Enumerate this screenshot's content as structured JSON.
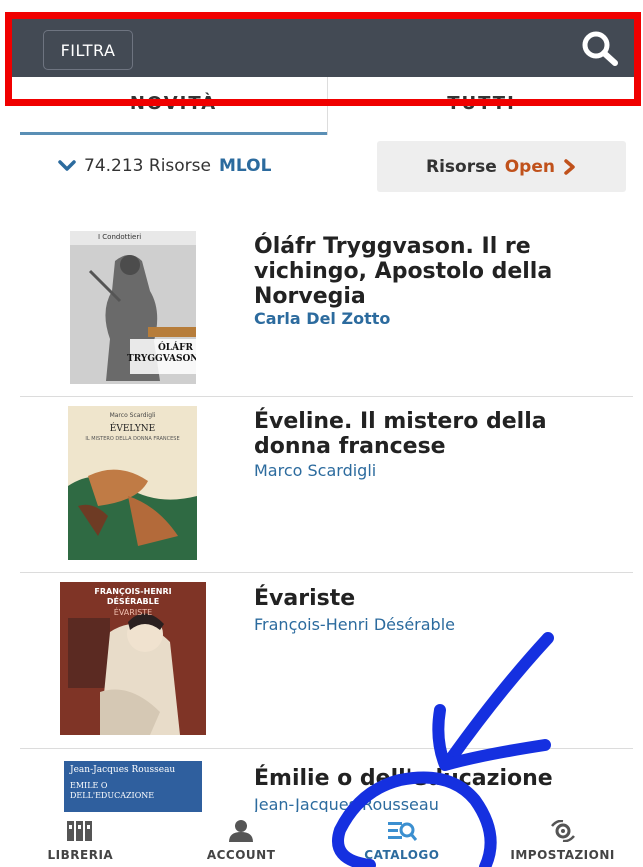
{
  "header": {
    "filter_label": "FILTRA",
    "search_icon": "search-icon"
  },
  "tabs": [
    {
      "label": "NOVITÀ",
      "active": true
    },
    {
      "label": "TUTTI",
      "active": false
    }
  ],
  "resources": {
    "mlol_count": "74.213 Risorse",
    "mlol_label": "MLOL",
    "open_prefix": "Risorse",
    "open_label": "Open"
  },
  "items": [
    {
      "title": "Óláfr Tryggvason. Il re vichingo, Apostolo della Norvegia",
      "author": "Carla Del Zotto",
      "cover_text": "ÓLÁFR TRYGGVASON",
      "cover_series": "I Condottieri"
    },
    {
      "title": "Éveline. Il mistero della donna francese",
      "author": "Marco Scardigli",
      "cover_text": "ÉVELYNE",
      "cover_sub": "IL MISTERO DELLA DONNA FRANCESE",
      "cover_author": "Marco Scardigli"
    },
    {
      "title": "Évariste",
      "author": "François-Henri Désérable",
      "cover_text": "ÉVARISTE",
      "cover_author": "FRANÇOIS-HENRI DÉSÉRABLE"
    },
    {
      "title": "Émilie o dell'educazione",
      "author": "Jean-Jacques Rousseau",
      "cover_author": "Jean-Jacques Rousseau",
      "cover_text": "EMILE O DELL'EDUCAZIONE"
    }
  ],
  "nav": [
    {
      "label": "LIBRERIA",
      "icon": "library-icon"
    },
    {
      "label": "ACCOUNT",
      "icon": "user-icon"
    },
    {
      "label": "CATALOGO",
      "icon": "catalog-search-icon",
      "active": true
    },
    {
      "label": "IMPOSTAZIONI",
      "icon": "gear-icon"
    }
  ],
  "colors": {
    "header_bg": "#434a54",
    "accent_blue": "#2c6b9e",
    "accent_orange": "#c0511b",
    "annotation_red": "#f00000",
    "scribble_blue": "#1530e0"
  }
}
